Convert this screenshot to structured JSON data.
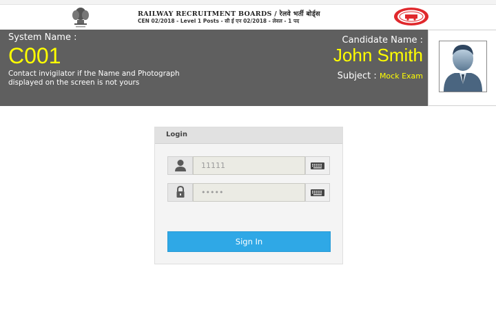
{
  "banner": {
    "line1": "RAILWAY RECRUITMENT BOARDS / रेलवे भर्ती बोर्ड्स",
    "line2": "CEN 02/2018 - Level 1 Posts - सी ई एन 02/2018 - लेवल - 1 पद"
  },
  "header": {
    "system_label": "System Name :",
    "system_value": "C001",
    "notice": "Contact invigilator if the Name and Photograph displayed on the screen is not yours",
    "candidate_label": "Candidate Name :",
    "candidate_value": "John Smith",
    "subject_label": "Subject :",
    "subject_value": "Mock Exam"
  },
  "login": {
    "title": "Login",
    "username_value": "11111",
    "password_value": "•••••",
    "signin_label": "Sign In"
  },
  "colors": {
    "header_bg": "#5f5f5f",
    "highlight": "#ffff00",
    "button": "#2fa8e6"
  },
  "icons": [
    "emblem-icon",
    "rrb-logo-icon",
    "user-icon",
    "lock-icon",
    "keyboard-icon"
  ]
}
